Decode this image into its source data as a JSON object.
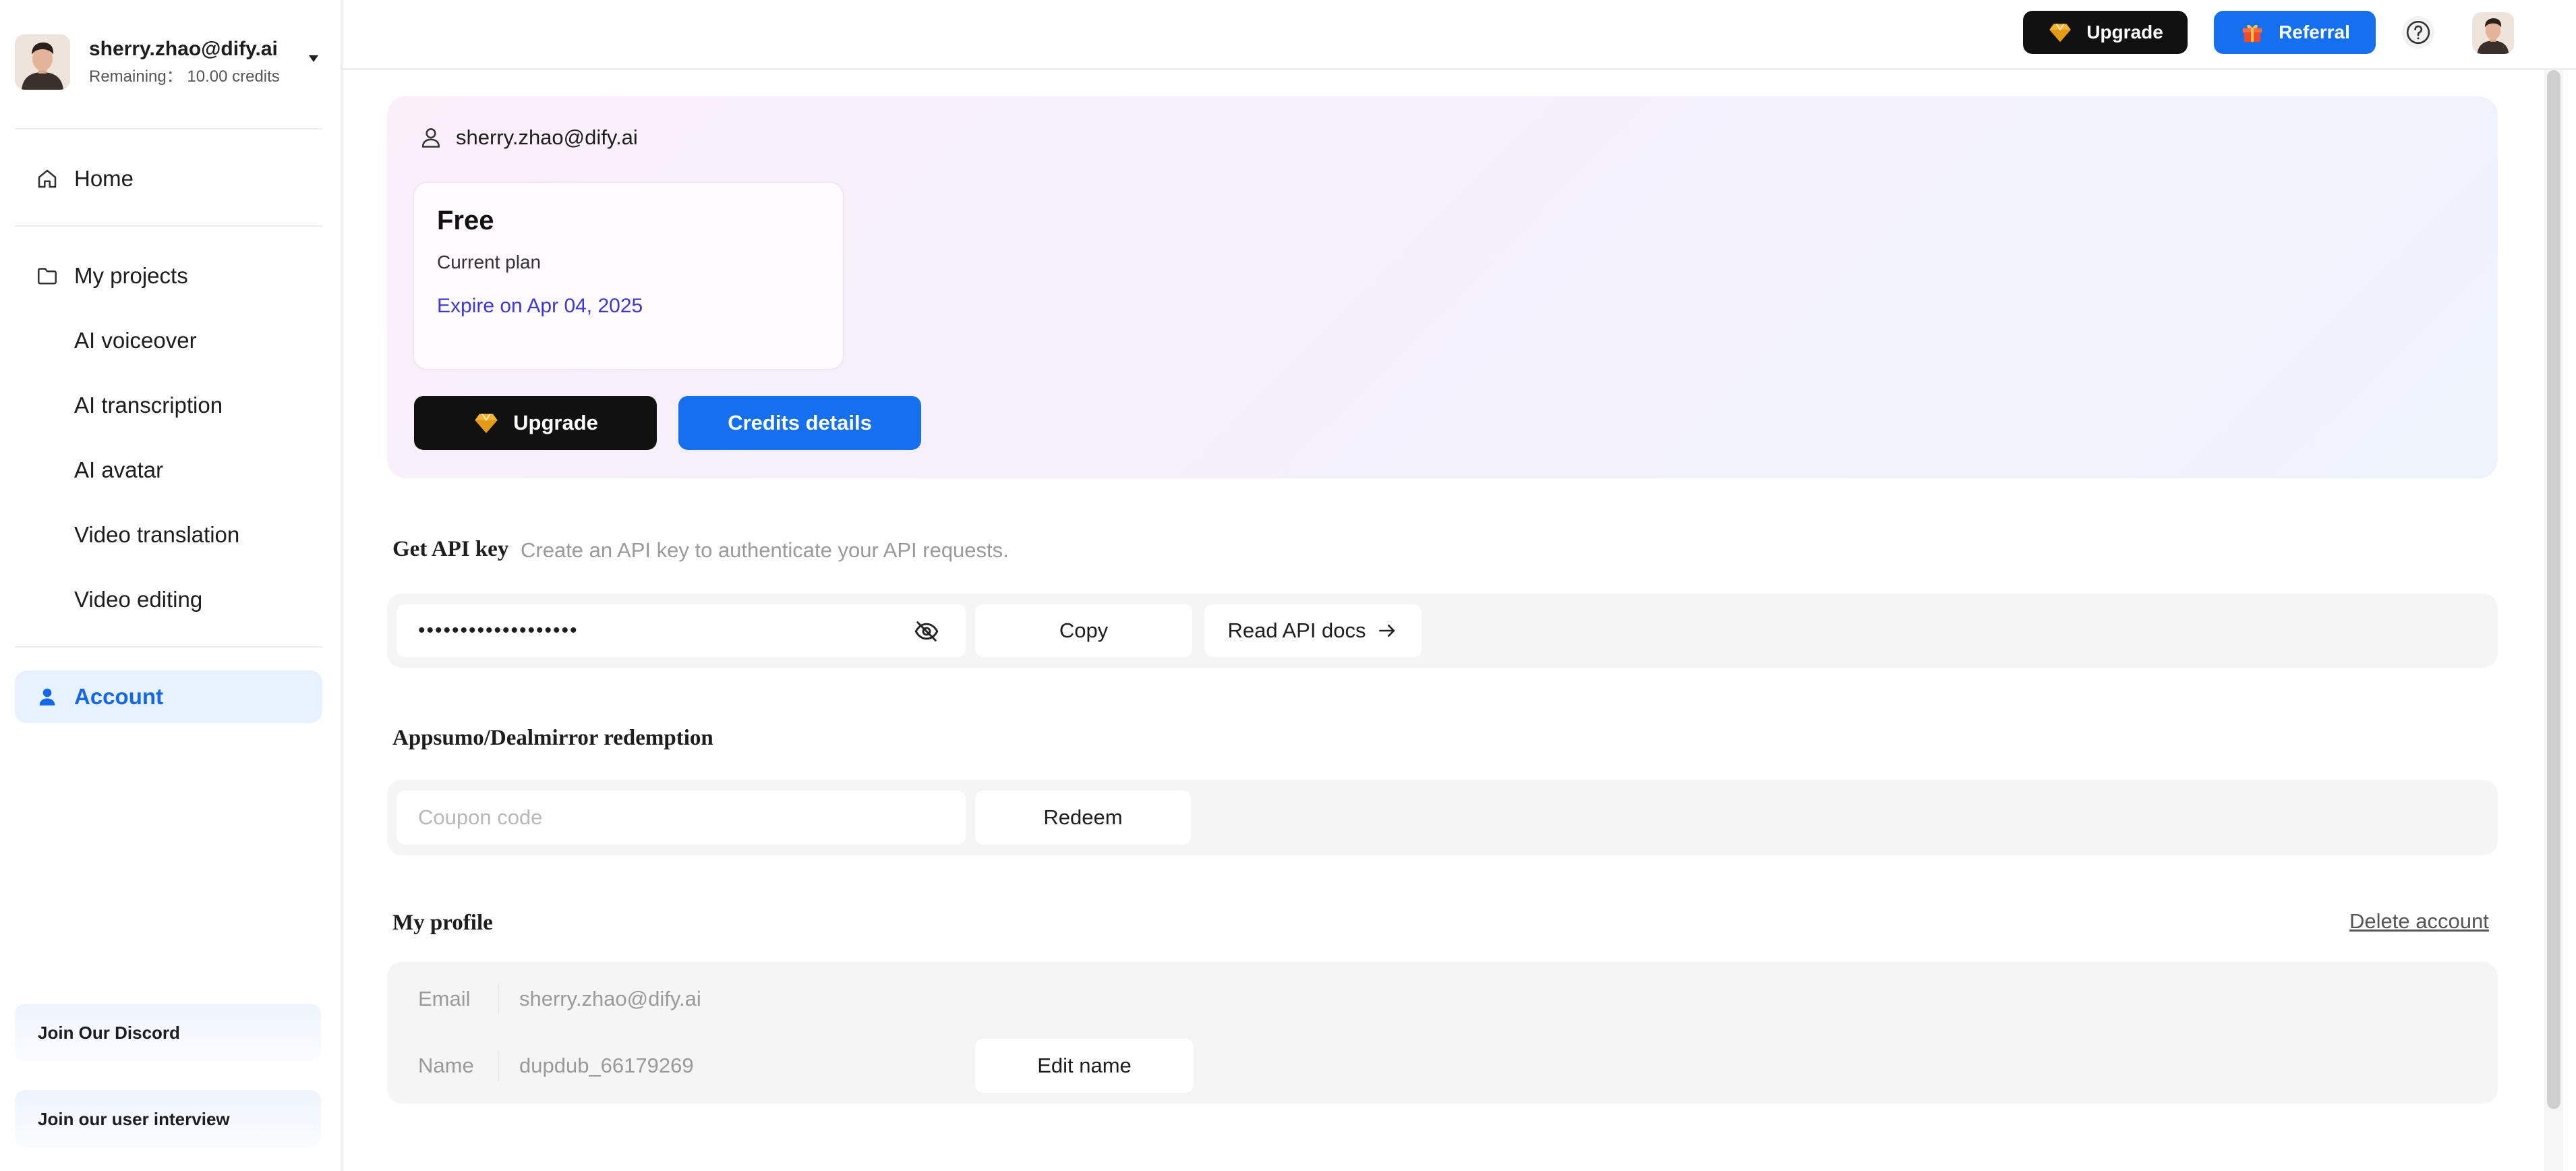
{
  "user": {
    "email": "sherry.zhao@dify.ai",
    "credits_text": "Remaining： 10.00 credits"
  },
  "sidebar": {
    "items": [
      {
        "label": "Home",
        "icon": "home-icon"
      },
      {
        "label": "My projects",
        "icon": "folder-icon"
      },
      {
        "label": "AI voiceover"
      },
      {
        "label": "AI transcription"
      },
      {
        "label": "AI avatar"
      },
      {
        "label": "Video translation"
      },
      {
        "label": "Video editing"
      },
      {
        "label": "Account",
        "icon": "user-icon",
        "active": true
      }
    ],
    "discord_label": "Join Our Discord",
    "interview_label": "Join our user interview"
  },
  "topbar": {
    "upgrade_label": "Upgrade",
    "referral_label": "Referral"
  },
  "plan": {
    "email": "sherry.zhao@dify.ai",
    "name": "Free",
    "subtitle": "Current plan",
    "expire": "Expire on Apr 04, 2025",
    "upgrade_label": "Upgrade",
    "credits_label": "Credits details"
  },
  "api": {
    "title": "Get API key",
    "description": "Create an API key to authenticate your API requests.",
    "masked_key": "•••••••••••••••••••",
    "copy_label": "Copy",
    "docs_label": "Read API docs"
  },
  "redeem": {
    "title": "Appsumo/Dealmirror redemption",
    "placeholder": "Coupon code",
    "button_label": "Redeem"
  },
  "profile": {
    "title": "My profile",
    "delete_label": "Delete account",
    "email_label": "Email",
    "email_value": "sherry.zhao@dify.ai",
    "name_label": "Name",
    "name_value": "dupdub_66179269",
    "edit_label": "Edit name"
  },
  "colors": {
    "accent": "#1570ef",
    "active_bg": "#e8f1ff",
    "dark_button": "#111111",
    "expire_text": "#3c38d0"
  }
}
